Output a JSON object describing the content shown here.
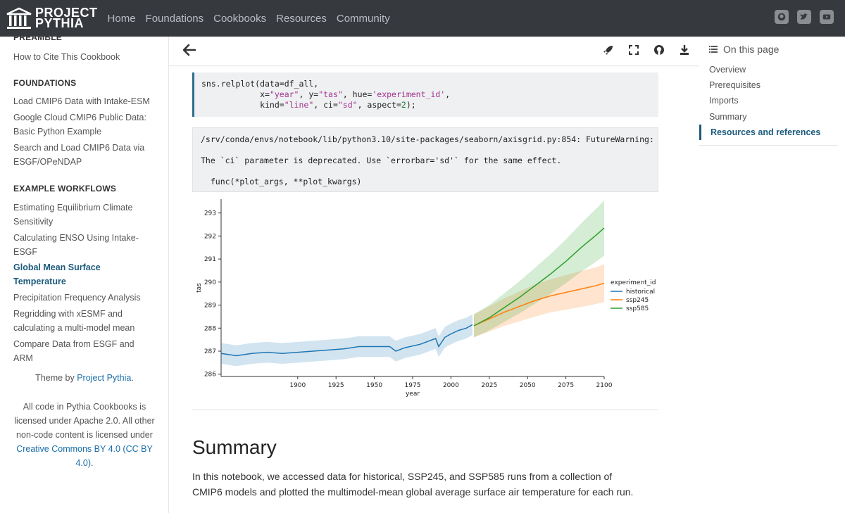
{
  "navbar": {
    "brand_line1": "PROJECT",
    "brand_line2": "PYTHIA",
    "links": [
      "Home",
      "Foundations",
      "Cookbooks",
      "Resources",
      "Community"
    ],
    "icons": [
      "github-icon",
      "twitter-icon",
      "youtube-icon"
    ]
  },
  "sidebar": {
    "preamble_heading": "PREAMBLE",
    "preamble_items": [
      "How to Cite This Cookbook"
    ],
    "foundations_heading": "FOUNDATIONS",
    "foundations_items": [
      "Load CMIP6 Data with Intake-ESM",
      "Google Cloud CMIP6 Public Data: Basic Python Example",
      "Search and Load CMIP6 Data via ESGF/OPeNDAP"
    ],
    "workflows_heading": "EXAMPLE WORKFLOWS",
    "workflows_items": [
      "Estimating Equilibrium Climate Sensitivity",
      "Calculating ENSO Using Intake-ESGF",
      "Global Mean Surface Temperature",
      "Precipitation Frequency Analysis",
      "Regridding with xESMF and calculating a multi-model mean",
      "Compare Data from ESGF and ARM"
    ],
    "theme_prefix": "Theme by ",
    "theme_link": "Project Pythia",
    "theme_suffix": ".",
    "license_text": "All code in Pythia Cookbooks is licensed under Apache 2.0. All other non-code content is licensed under ",
    "license_link": "Creative Commons BY 4.0 (CC BY 4.0)",
    "license_suffix": "."
  },
  "code": {
    "line1": "sns.relplot(data=df_all,",
    "line2_a": "            x=",
    "line2_x": "\"year\"",
    "line2_b": ", y=",
    "line2_y": "\"tas\"",
    "line2_c": ", hue=",
    "line2_hue": "'experiment_id'",
    "line2_d": ",",
    "line3_a": "            kind=",
    "line3_kind": "\"line\"",
    "line3_b": ", ci=",
    "line3_ci": "\"sd\"",
    "line3_c": ", aspect=",
    "line3_aspect": "2",
    "line3_d": ");"
  },
  "output": {
    "line1": "/srv/conda/envs/notebook/lib/python3.10/site-packages/seaborn/axisgrid.py:854: FutureWarning:",
    "line2": "The `ci` parameter is deprecated. Use `errorbar='sd'` for the same effect.",
    "line3": "  func(*plot_args, **plot_kwargs)"
  },
  "chart_data": {
    "type": "line",
    "xlabel": "year",
    "ylabel": "tas",
    "xlim": [
      1850,
      2100
    ],
    "ylim": [
      285.9,
      293.6
    ],
    "xticks": [
      1900,
      1925,
      1950,
      1975,
      2000,
      2025,
      2050,
      2075,
      2100
    ],
    "yticks": [
      286,
      287,
      288,
      289,
      290,
      291,
      292,
      293
    ],
    "legend_title": "experiment_id",
    "legend_position": "right",
    "series": [
      {
        "name": "historical",
        "color": "#1f77b4",
        "x": [
          1850,
          1860,
          1870,
          1880,
          1890,
          1900,
          1910,
          1920,
          1930,
          1940,
          1950,
          1960,
          1964,
          1970,
          1980,
          1990,
          1992,
          1996,
          2000,
          2005,
          2010,
          2014
        ],
        "y": [
          286.9,
          286.8,
          286.9,
          286.95,
          286.9,
          286.95,
          287.0,
          287.05,
          287.1,
          287.2,
          287.2,
          287.2,
          287.0,
          287.15,
          287.3,
          287.55,
          287.2,
          287.6,
          287.75,
          287.9,
          288.0,
          288.15
        ],
        "sd": [
          0.45,
          0.45,
          0.45,
          0.45,
          0.45,
          0.45,
          0.45,
          0.45,
          0.45,
          0.45,
          0.45,
          0.45,
          0.45,
          0.45,
          0.45,
          0.45,
          0.45,
          0.45,
          0.45,
          0.45,
          0.45,
          0.45
        ]
      },
      {
        "name": "ssp245",
        "color": "#ff7f0e",
        "x": [
          2015,
          2025,
          2035,
          2045,
          2055,
          2065,
          2075,
          2085,
          2095,
          2100
        ],
        "y": [
          288.1,
          288.4,
          288.7,
          288.95,
          289.2,
          289.4,
          289.55,
          289.7,
          289.85,
          289.95
        ],
        "sd": [
          0.5,
          0.55,
          0.6,
          0.65,
          0.7,
          0.72,
          0.75,
          0.78,
          0.8,
          0.82
        ]
      },
      {
        "name": "ssp585",
        "color": "#2ca02c",
        "x": [
          2015,
          2025,
          2035,
          2045,
          2055,
          2065,
          2075,
          2085,
          2095,
          2100
        ],
        "y": [
          288.1,
          288.45,
          288.9,
          289.35,
          289.85,
          290.35,
          290.9,
          291.5,
          292.05,
          292.35
        ],
        "sd": [
          0.5,
          0.55,
          0.62,
          0.7,
          0.78,
          0.86,
          0.95,
          1.05,
          1.15,
          1.2
        ]
      }
    ]
  },
  "summary": {
    "title": "Summary",
    "text": "In this notebook, we accessed data for historical, SSP245, and SSP585 runs from a collection of CMIP6 models and plotted the multimodel-mean global average surface air temperature for each run."
  },
  "toc": {
    "heading": "On this page",
    "items": [
      "Overview",
      "Prerequisites",
      "Imports",
      "Summary",
      "Resources and references"
    ]
  }
}
